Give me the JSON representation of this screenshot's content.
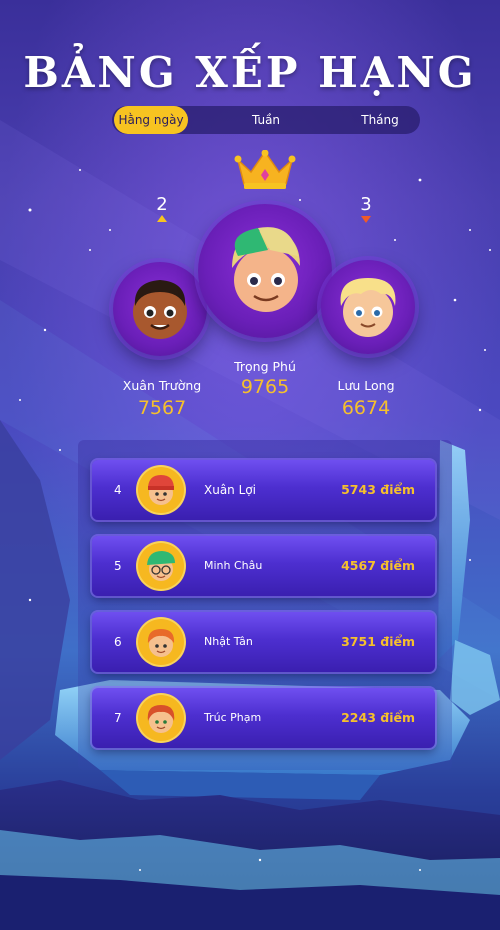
{
  "title": "BẢNG XẾP HẠNG",
  "tabs": [
    {
      "label": "Hằng ngày",
      "active": true
    },
    {
      "label": "Tuần",
      "active": false
    },
    {
      "label": "Tháng",
      "active": false
    }
  ],
  "podium": {
    "first": {
      "rank": "1",
      "name": "Trọng Phú",
      "score": "9765"
    },
    "second": {
      "rank": "2",
      "name": "Xuân Trường",
      "score": "7567",
      "trend": "up"
    },
    "third": {
      "rank": "3",
      "name": "Lưu Long",
      "score": "6674",
      "trend": "down"
    }
  },
  "list": [
    {
      "rank": "4",
      "name": "Xuân Lợi",
      "score": "5743 điểm"
    },
    {
      "rank": "5",
      "name": "Minh Châu",
      "score": "4567 điểm"
    },
    {
      "rank": "6",
      "name": "Nhật Tân",
      "score": "3751 điểm"
    },
    {
      "rank": "7",
      "name": "Trúc Phạm",
      "score": "2243 điểm"
    }
  ],
  "colors": {
    "accent": "#f7c321",
    "score": "#f6c02c",
    "trend_up": "#f7c321",
    "trend_down": "#f05a28"
  }
}
